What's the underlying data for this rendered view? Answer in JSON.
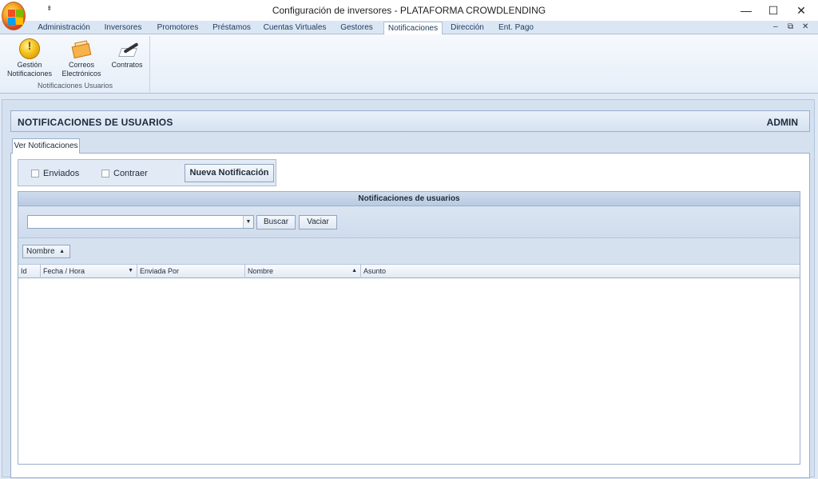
{
  "window": {
    "title": "Configuración de inversores - PLATAFORMA CROWDLENDING",
    "qat_glyph": "⇟",
    "minimize_glyph": "—",
    "maximize_glyph": "☐",
    "close_glyph": "✕"
  },
  "menu_tabs": [
    {
      "label": "Administración"
    },
    {
      "label": "Inversores"
    },
    {
      "label": "Promotores"
    },
    {
      "label": "Préstamos"
    },
    {
      "label": "Cuentas Virtuales"
    },
    {
      "label": "Gestores"
    },
    {
      "label": "Notificaciones",
      "active": true
    },
    {
      "label": "Dirección"
    },
    {
      "label": "Ent. Pago"
    }
  ],
  "mdi_controls": {
    "minimize": "–",
    "restore": "⧉",
    "close": "✕"
  },
  "ribbon": {
    "group_label": "Notificaciones Usuarios",
    "buttons": [
      {
        "label_line1": "Gestión",
        "label_line2": "Notificaciones",
        "icon": "notification-bulb-icon"
      },
      {
        "label_line1": "Correos",
        "label_line2": "Electrónicos",
        "icon": "envelope-icon"
      },
      {
        "label_line1": "Contratos",
        "label_line2": "",
        "icon": "contract-pen-icon"
      }
    ]
  },
  "header": {
    "title": "NOTIFICACIONES DE USUARIOS",
    "user": "ADMIN"
  },
  "tab_page": {
    "label": "Ver Notificaciones"
  },
  "options": {
    "enviados_label": "Enviados",
    "contraer_label": "Contraer",
    "new_button": "Nueva Notificación"
  },
  "grid": {
    "title": "Notificaciones de usuarios",
    "search_value": "",
    "dropdown_glyph": "▼",
    "search_button": "Buscar",
    "clear_button": "Vaciar",
    "group_by": "Nombre",
    "sort_up_glyph": "▲",
    "sort_down_glyph": "▼",
    "columns": [
      {
        "label": "Id",
        "sort": ""
      },
      {
        "label": "Fecha / Hora",
        "sort": "down"
      },
      {
        "label": "Enviada Por",
        "sort": ""
      },
      {
        "label": "Nombre",
        "sort": "up"
      },
      {
        "label": "Asunto",
        "sort": ""
      }
    ],
    "rows": []
  }
}
